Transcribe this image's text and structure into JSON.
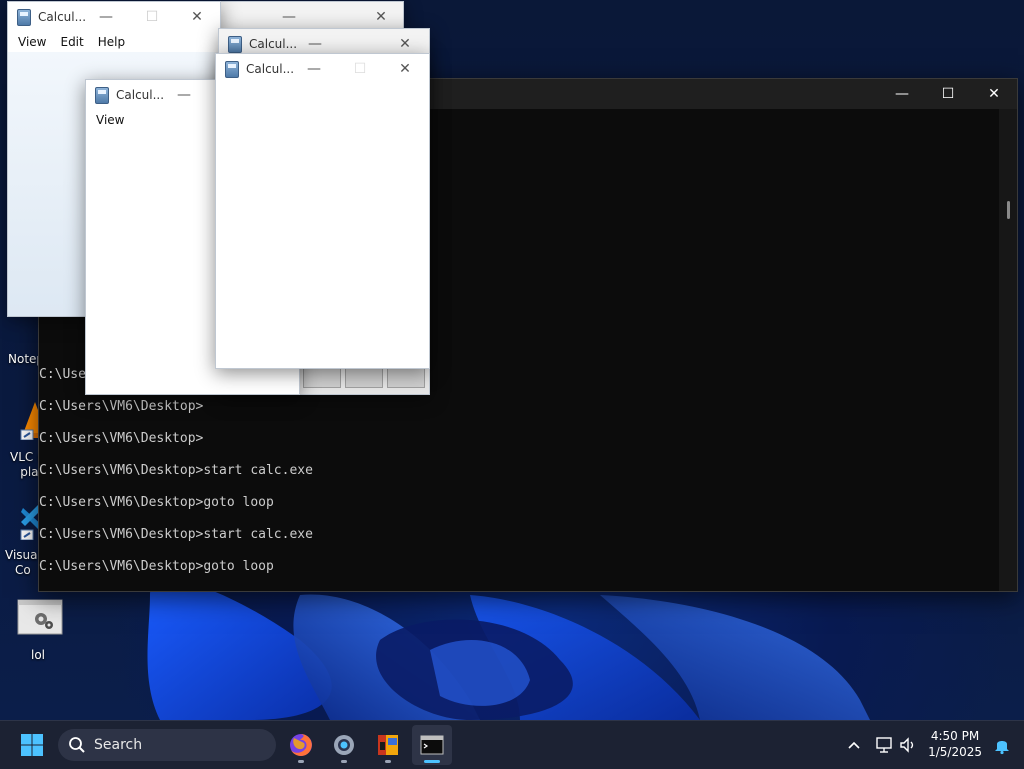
{
  "desktop": {
    "icons": [
      {
        "label": "Notep"
      },
      {
        "label": "VLC m\npla"
      },
      {
        "label": "Visual\nCo"
      },
      {
        "label": "lol"
      }
    ]
  },
  "terminal": {
    "lines": [
      "C:\\Users\\VM6\\Desktop>",
      "C:\\Users\\VM6\\Desktop>",
      "C:\\Users\\VM6\\Desktop>",
      "C:\\Users\\VM6\\Desktop>start calc.exe",
      "C:\\Users\\VM6\\Desktop>goto loop",
      "C:\\Users\\VM6\\Desktop>start calc.exe",
      "C:\\Users\\VM6\\Desktop>goto loop"
    ],
    "controls": {
      "minimize": "—",
      "maximize": "☐",
      "close": "✕"
    }
  },
  "calculators": [
    {
      "title": "Calcul...",
      "menu": [
        "View",
        "Edit",
        "Help"
      ]
    },
    {
      "title": "Calcul...",
      "menu": [
        "View"
      ]
    },
    {
      "title": "Calcul...",
      "menu": []
    },
    {
      "title": "Calcul...",
      "menu": []
    },
    {
      "title": "Calcul...",
      "menu": []
    }
  ],
  "calc_controls": {
    "minimize": "—",
    "maximize": "☐",
    "close": "✕"
  },
  "taskbar": {
    "search_label": "Search",
    "apps": [
      "start-button",
      "firefox",
      "settings",
      "file-explorer",
      "terminal"
    ],
    "tray": {
      "time": "4:50 PM",
      "date": "1/5/2025"
    }
  },
  "colors": {
    "taskbar": "#1c2233",
    "terminal_bg": "#0c0c0c",
    "terminal_text": "#cccccc",
    "accent": "#4cc2ff"
  }
}
